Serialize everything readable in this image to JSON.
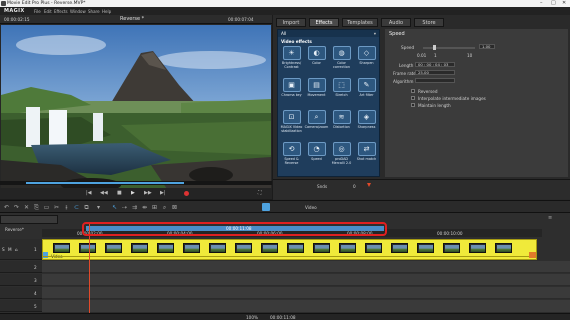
{
  "window": {
    "title": "Movie Edit Pro Plus - Reverse.MVP*",
    "controls": [
      "minimize-icon",
      "maximize-icon",
      "close-icon"
    ]
  },
  "menu": {
    "logo": "MAGIX",
    "items": [
      "File",
      "Edit",
      "Effects",
      "Window",
      "Share",
      "Help"
    ]
  },
  "preview": {
    "time_left": "00:00:02:15",
    "title": "Reverse *",
    "time_right": "00:00:07:04"
  },
  "media": {
    "tabs": [
      "Import",
      "Effects",
      "Templates",
      "Audio",
      "Store"
    ],
    "active_tab": "Effects",
    "dropdown_value": "All",
    "category": "Video effects",
    "effects": [
      {
        "label": "Brightness/ Contrast",
        "icon": "sun-icon"
      },
      {
        "label": "Color",
        "icon": "color-icon"
      },
      {
        "label": "Color correction",
        "icon": "palette-icon"
      },
      {
        "label": "Sharpen",
        "icon": "sharpen-icon"
      },
      {
        "label": "Chroma key",
        "icon": "key-icon"
      },
      {
        "label": "Movement",
        "icon": "movement-icon"
      },
      {
        "label": "Stretch",
        "icon": "stretch-icon"
      },
      {
        "label": "Art filter",
        "icon": "brush-icon"
      },
      {
        "label": "MAGIX Video stabilization",
        "icon": "stabilize-icon"
      },
      {
        "label": "Camera/zoom",
        "icon": "camera-icon"
      },
      {
        "label": "Distortion",
        "icon": "distortion-icon"
      },
      {
        "label": "Sharpness",
        "icon": "sharpness-icon"
      },
      {
        "label": "Speed & Reverse",
        "icon": "speed-icon"
      },
      {
        "label": "Speed",
        "icon": "speedometer-icon"
      },
      {
        "label": "proDAD Mercalli 2.0",
        "icon": "mercalli-icon"
      },
      {
        "label": "Shot match",
        "icon": "match-icon"
      }
    ],
    "settings": {
      "heading": "Speed",
      "speed_label": "Speed",
      "speed_value": "1.00",
      "scale_labels": [
        "0.01",
        "1",
        "10"
      ],
      "length_label": "Length",
      "length_value": "00 : 00 : 04 : 03",
      "frame_rate_label": "Frame rate",
      "frame_rate_value": "25.00",
      "algorithm_label": "Algorithm",
      "options": [
        "Reversed",
        "Interpolate intermediate images",
        "Maintain length"
      ]
    },
    "footer_value": "Snds",
    "playhead_hint": "0"
  },
  "toolbar": {
    "mode_label": "Video"
  },
  "timeline": {
    "tab_name": "Reverse*",
    "ruler_marks": [
      "00:00:02:00",
      "00:00:04:00",
      "00:00:06:00",
      "00:00:08:00",
      "00:00:10:00"
    ],
    "range_label": "00:00:11:08",
    "track_numbers": [
      "1",
      "2",
      "3",
      "4",
      "5",
      "6"
    ],
    "clip_name": "Video"
  },
  "status": {
    "zoom": "100%",
    "info": "00:00:11:08"
  }
}
